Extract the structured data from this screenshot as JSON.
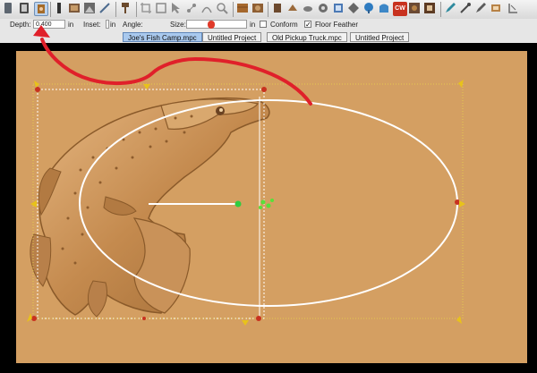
{
  "toolbar": {
    "tools": [
      {
        "name": "new-file-icon",
        "color": "#5d6670"
      },
      {
        "name": "open-file-icon",
        "color": "#4a4a4a"
      },
      {
        "name": "active-relief-tool-icon",
        "color": "#a56c2a"
      },
      {
        "name": "split-view-icon",
        "color": "#333333"
      },
      {
        "name": "image-import-icon",
        "color": "#7d5a3c"
      },
      {
        "name": "image-preview-icon",
        "color": "#6a6a6a"
      },
      {
        "name": "paint-brush-icon",
        "color": "#4d6b8f"
      },
      {
        "name": "stamp-tool-icon",
        "color": "#6b4a2c"
      },
      {
        "name": "crop-icon",
        "color": "#9a9a9a"
      },
      {
        "name": "shape-tool-icon",
        "color": "#8a8a8a"
      },
      {
        "name": "select-tool-icon",
        "color": "#8a8a8a"
      },
      {
        "name": "node-edit-icon",
        "color": "#8a8a8a"
      },
      {
        "name": "vector-tool-icon",
        "color": "#8a8a8a"
      },
      {
        "name": "zoom-icon",
        "color": "#8a8a8a"
      },
      {
        "name": "wood-texture-icon",
        "color": "#a5672c"
      },
      {
        "name": "relief-texture-icon",
        "color": "#8f5f33"
      },
      {
        "name": "emboss-icon",
        "color": "#6d4a2e"
      },
      {
        "name": "carve-icon",
        "color": "#9b6a3b"
      },
      {
        "name": "smooth-tool-icon",
        "color": "#7c7c7c"
      },
      {
        "name": "smudge-tool-icon",
        "color": "#6d6d6d"
      },
      {
        "name": "scale-tool-icon",
        "color": "#4b79b5"
      },
      {
        "name": "offset-tool-icon",
        "color": "#666666"
      },
      {
        "name": "tree-icon",
        "color": "#2f7cc1"
      },
      {
        "name": "mold-icon",
        "color": "#3d87c7"
      },
      {
        "name": "cw-icon",
        "color": "#c8321f"
      },
      {
        "name": "texture-photo-icon",
        "color": "#6b4a34"
      },
      {
        "name": "frame-tool-icon",
        "color": "#5d3b23"
      },
      {
        "name": "pen-icon",
        "color": "#2e8a9e"
      },
      {
        "name": "sculpt-icon",
        "color": "#4a4a4a"
      },
      {
        "name": "eraser-icon",
        "color": "#b78246"
      },
      {
        "name": "measure-icon",
        "color": "#6a6a6a"
      }
    ]
  },
  "options": {
    "depth_label": "Depth:",
    "depth_value": "0.400",
    "in_unit": "in",
    "inset_label": "Inset:",
    "angle_label": "Angle:",
    "size_label": "Size:",
    "conform_label": "Conform",
    "conform_checked": false,
    "floor_feather_label": "Floor Feather",
    "floor_feather_checked": true
  },
  "tabs": [
    {
      "label": "Joe's Fish Camp.mpc",
      "active": true
    },
    {
      "label": "Untitled Project",
      "active": false
    },
    {
      "label": "Old Pickup Truck.mpc",
      "active": false
    },
    {
      "label": "Untitled Project",
      "active": false
    }
  ],
  "canvas": {
    "board_color": "#d49f62",
    "relief_color": "#c48a4e",
    "selection_color": "#e8d64a",
    "annotation_arrow_color": "#e0202a",
    "handle_color": "#c8321f"
  }
}
